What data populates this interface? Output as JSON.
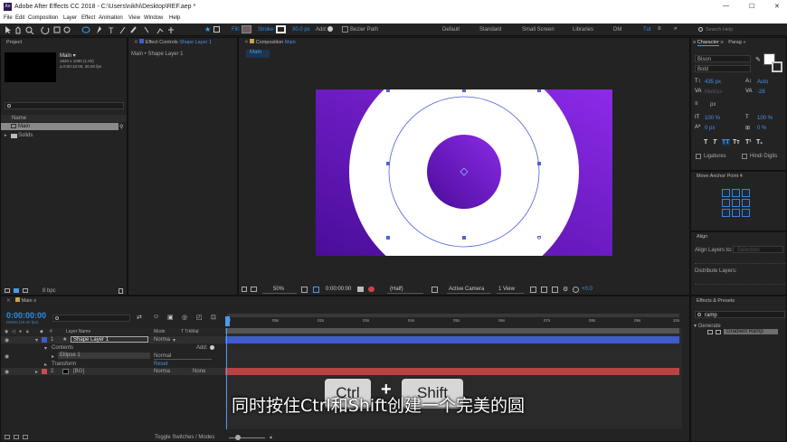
{
  "window": {
    "title": "Adobe After Effects CC 2018 - C:\\Users\\nikhi\\Desktop\\REF.aep *",
    "minimize": "—",
    "maximize": "☐",
    "close": "✕",
    "app_badge": "Ae"
  },
  "menu": [
    "File",
    "Edit",
    "Composition",
    "Layer",
    "Effect",
    "Animation",
    "View",
    "Window",
    "Help"
  ],
  "toolbar": {
    "fill_label": "Fill:",
    "stroke_label": "Stroke:",
    "stroke_width": "30.0 px",
    "add_label": "Add:",
    "bezier_label": "Bezier Path",
    "workspaces": [
      "Default",
      "Standard",
      "Small Screen",
      "Libraries",
      "DM",
      "Tut"
    ],
    "active_workspace": "Tut",
    "search_placeholder": "Search Help"
  },
  "project": {
    "tab": "Project",
    "comp_name": "Main ▾",
    "comp_info": [
      "1920 x 1080 (1.00)",
      "Δ 0:00:10:00, 30.00 fps"
    ],
    "search_placeholder": "",
    "col_name": "Name",
    "items": [
      "Main",
      "Solids"
    ],
    "bpc": "8 bpc"
  },
  "effect_controls": {
    "tab": "Effect Controls",
    "layer": "Shape Layer 1",
    "breadcrumb": "Main • Shape Layer 1"
  },
  "composition": {
    "tab": "Composition",
    "name": "Main",
    "sub_tab": "Main",
    "zoom": "50%",
    "timecode": "0:00:00:00",
    "resolution": "(Half)",
    "camera": "Active Camera",
    "views": "1 View",
    "exposure": "+0.0"
  },
  "character": {
    "tab": "Character",
    "tab2": "Parag",
    "font": "Bison",
    "style": "Bold",
    "size": "435 px",
    "leading": "Auto",
    "tracking_metrics": "Metrics",
    "tracking": "-28",
    "stroke_unit": "px",
    "vscale": "100 %",
    "hscale": "100 %",
    "baseline": "0 px",
    "tsume": "0 %",
    "ligatures": "Ligatures",
    "hindi": "Hindi Digits",
    "tt_buttons": [
      "T",
      "T",
      "TT",
      "Tт",
      "T¹",
      "T₁"
    ]
  },
  "anchor": {
    "tab": "Move Anchor Point 4"
  },
  "align": {
    "tab": "Align",
    "align_to_label": "Align Layers to:",
    "align_to_value": "Selection",
    "distribute": "Distribute Layers:"
  },
  "effects": {
    "tab": "Effects & Presets",
    "search": "ramp",
    "category": "Generate",
    "item": "Gradient Ramp"
  },
  "timeline": {
    "tab": "Main",
    "timecode": "0:00:00:00",
    "frame_info": "00000 (30.00 fps)",
    "col_layer": "Layer Name",
    "col_mode": "Mode",
    "col_trk": "T TrkMat",
    "ruler": [
      "0f",
      "05s",
      "02s",
      "03s",
      "04s",
      "05s",
      "06s",
      "07s",
      "08s",
      "09s",
      "10s"
    ],
    "layers": [
      {
        "num": "1",
        "name": "Shape Layer 1",
        "mode": "Norma"
      },
      {
        "num": "2",
        "name": "[BG]",
        "mode": "Norma",
        "trk": "None"
      }
    ],
    "contents": "Contents",
    "add": "Add:",
    "ellipse": "Ellipse 1",
    "ellipse_mode": "Normal",
    "transform": "Transform",
    "reset": "Reset",
    "toggle": "Toggle Switches / Modes"
  },
  "overlay": {
    "key1": "Ctrl",
    "plus": "+",
    "key2": "Shift",
    "subtitle": "同时按住Ctrl和Shift创建一个完美的圆"
  },
  "colors": {
    "accent": "#2d8ceb",
    "purple_a": "#5a12a8",
    "purple_b": "#8a2be2",
    "layer_red": "#b94343",
    "layer_blue": "#3f5ccc"
  }
}
